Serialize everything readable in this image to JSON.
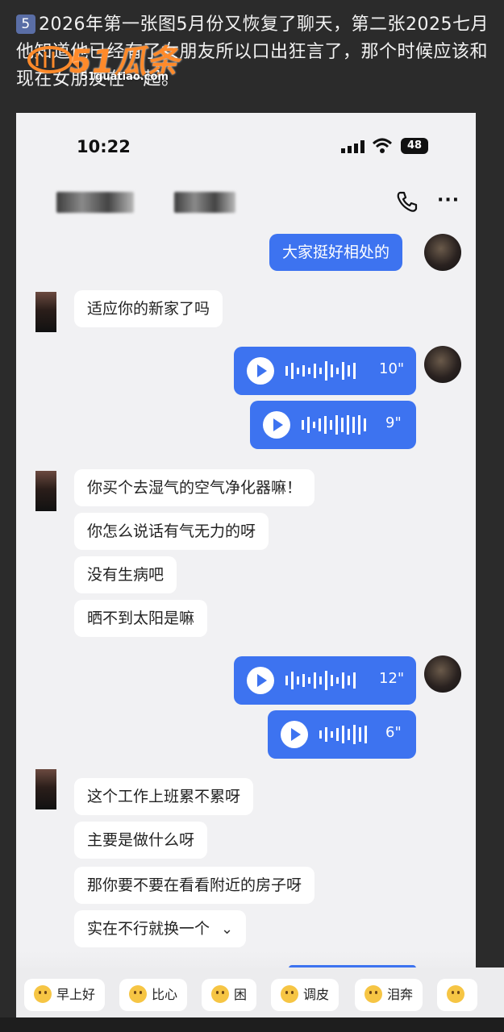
{
  "caption": {
    "badge": "5",
    "text": "2026年第一张图5月份又恢复了聊天，第二张2025七月他知道他已经有了女朋友所以口出狂言了，那个时候应该和现在女朋友在一起。"
  },
  "watermark": {
    "logo": "51瓜条",
    "url": "51guatiao.com"
  },
  "status_bar": {
    "time": "10:22",
    "battery": "48"
  },
  "header": {
    "call_icon": "phone-icon",
    "more_label": "···"
  },
  "messages": {
    "m1": "大家挺好相处的",
    "m2": "适应你的新家了吗",
    "v1": "10\"",
    "v2": "9\"",
    "m3": "你买个去湿气的空气净化器嘛！",
    "m4": "你怎么说话有气无力的呀",
    "m5": "没有生病吧",
    "m6": "晒不到太阳是嘛",
    "v3": "12\"",
    "v4": "6\"",
    "m7": "这个工作上班累不累呀",
    "m8": "主要是做什么呀",
    "m9": "那你要不要在看看附近的房子呀",
    "m10": "实在不行就换一个",
    "m10_chevron": "⌄"
  },
  "quick_replies": [
    "早上好",
    "比心",
    "困",
    "调皮",
    "泪奔"
  ],
  "colors": {
    "accent": "#3d73f0",
    "background": "#f1f1f3"
  }
}
